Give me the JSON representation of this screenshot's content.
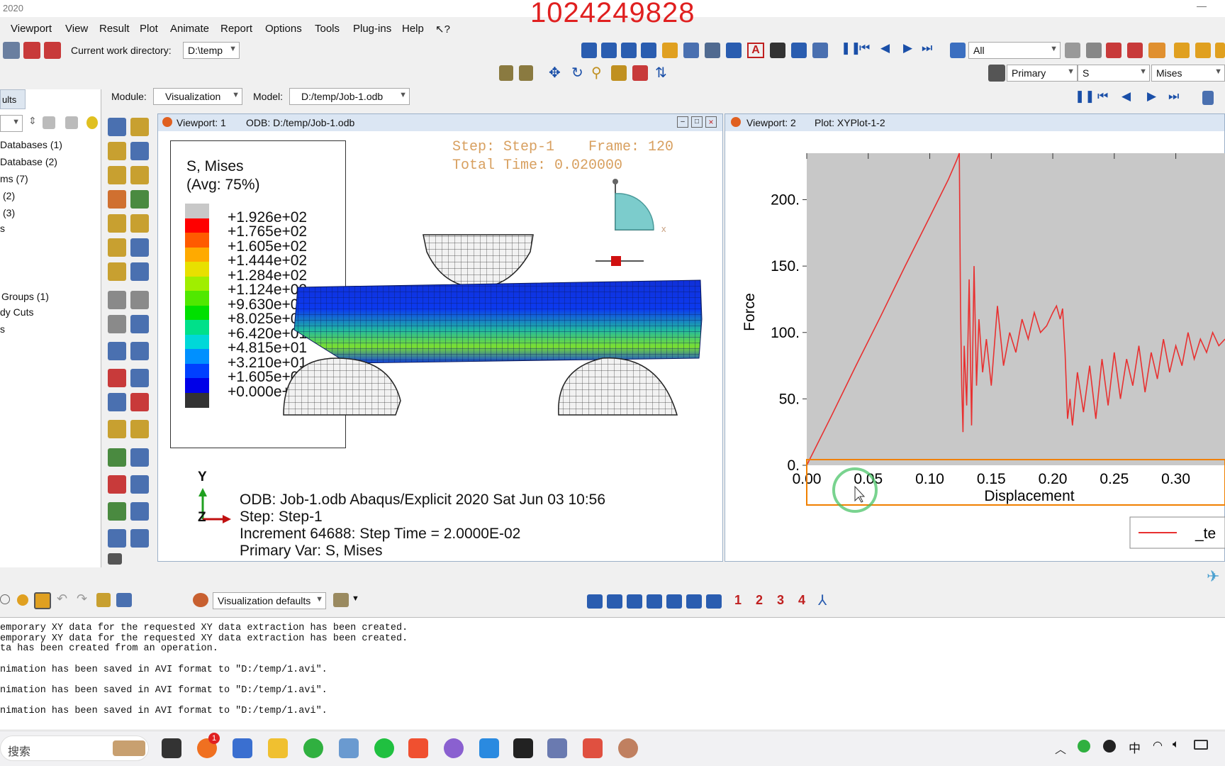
{
  "window": {
    "title": "2020",
    "watermark": "1024249828"
  },
  "menu": [
    "Viewport",
    "View",
    "Result",
    "Plot",
    "Animate",
    "Report",
    "Options",
    "Tools",
    "Plug-ins",
    "Help",
    "↖?"
  ],
  "toolbar": {
    "cwd_label": "Current work directory:",
    "cwd_value": "D:\\temp",
    "selection_filter": "All",
    "primary": "Primary",
    "field": "S",
    "invariant": "Mises"
  },
  "context": {
    "module_label": "Module:",
    "module_value": "Visualization",
    "model_label": "Model:",
    "model_value": "D:/temp/Job-1.odb"
  },
  "tree": {
    "tab": "ults",
    "items": [
      "Databases (1)",
      "Database (2)",
      "ms (7)",
      "(2)",
      "(3)",
      "s",
      "Groups (1)",
      "dy Cuts",
      "s"
    ]
  },
  "viewport1": {
    "title": "Viewport: 1",
    "odb": "ODB: D:/temp/Job-1.odb",
    "legend_title": "S, Mises",
    "legend_avg": "(Avg: 75%)",
    "legend_values": [
      "+1.926e+02",
      "+1.765e+02",
      "+1.605e+02",
      "+1.444e+02",
      "+1.284e+02",
      "+1.124e+02",
      "+9.630e+01",
      "+8.025e+01",
      "+6.420e+01",
      "+4.815e+01",
      "+3.210e+01",
      "+1.605e+01",
      "+0.000e+00"
    ],
    "legend_colors": [
      "#c8c8c8",
      "#ff0000",
      "#ff5a00",
      "#ffaa00",
      "#e8e000",
      "#a0ee00",
      "#50e800",
      "#00e000",
      "#00e08a",
      "#00d8d8",
      "#0090ff",
      "#0040ff",
      "#0000e8",
      "#333333"
    ],
    "step_line": "Step: Step-1    Frame: 120",
    "time_line": "Total Time: 0.020000",
    "axis_y": "Y",
    "axis_zx": "Z",
    "info_line1": "ODB: Job-1.odb    Abaqus/Explicit 2020    Sat Jun 03 10:56",
    "info_line2": "Step: Step-1",
    "info_line3": "Increment     64688: Step Time =     2.0000E-02",
    "info_line4": "Primary Var: S, Mises"
  },
  "viewport2": {
    "title": "Viewport: 2",
    "plot": "Plot: XYPlot-1-2",
    "legend_entry": "_te"
  },
  "chart_data": {
    "type": "line",
    "title": "",
    "xlabel": "Displacement",
    "ylabel": "Force",
    "xlim": [
      0,
      0.34
    ],
    "ylim": [
      0,
      235
    ],
    "x_ticks": [
      "0.00",
      "0.05",
      "0.10",
      "0.15",
      "0.20",
      "0.25",
      "0.30",
      "0."
    ],
    "y_ticks": [
      "0.",
      "50.",
      "100.",
      "150.",
      "200."
    ],
    "series": [
      {
        "name": "_te",
        "color": "#e83030",
        "x": [
          0.0,
          0.02,
          0.04,
          0.06,
          0.08,
          0.1,
          0.115,
          0.122,
          0.124,
          0.125,
          0.126,
          0.127,
          0.128,
          0.13,
          0.132,
          0.134,
          0.136,
          0.138,
          0.14,
          0.143,
          0.146,
          0.15,
          0.155,
          0.16,
          0.165,
          0.17,
          0.175,
          0.18,
          0.185,
          0.19,
          0.195,
          0.2,
          0.203,
          0.206,
          0.208,
          0.21,
          0.212,
          0.214,
          0.216,
          0.22,
          0.225,
          0.23,
          0.235,
          0.24,
          0.245,
          0.25,
          0.255,
          0.26,
          0.265,
          0.27,
          0.275,
          0.28,
          0.285,
          0.29,
          0.295,
          0.3,
          0.305,
          0.31,
          0.315,
          0.32,
          0.325,
          0.33,
          0.335,
          0.34
        ],
        "y": [
          0,
          37,
          75,
          112,
          150,
          187,
          215,
          230,
          235,
          120,
          60,
          25,
          90,
          45,
          140,
          30,
          150,
          60,
          110,
          70,
          95,
          60,
          120,
          75,
          100,
          85,
          110,
          95,
          115,
          100,
          105,
          115,
          120,
          110,
          118,
          85,
          35,
          50,
          30,
          70,
          40,
          75,
          35,
          80,
          45,
          85,
          50,
          80,
          60,
          90,
          55,
          85,
          65,
          95,
          70,
          90,
          75,
          100,
          80,
          95,
          85,
          100,
          90,
          95
        ]
      }
    ]
  },
  "bottom_toolbar": {
    "defaults": "Visualization defaults",
    "numbers": [
      "1",
      "2",
      "3",
      "4"
    ]
  },
  "messages": [
    "emporary XY data for the requested XY data extraction has been created.",
    "emporary XY data for the requested XY data extraction has been created.",
    "ta has been created from an operation.",
    "",
    "nimation has been saved in AVI format to \"D:/temp/1.avi\".",
    "",
    "nimation has been saved in AVI format to \"D:/temp/1.avi\".",
    "",
    "nimation has been saved in AVI format to \"D:/temp/1.avi\"."
  ],
  "taskbar": {
    "search": "搜索",
    "ime": "中",
    "notification_badge": "1"
  }
}
